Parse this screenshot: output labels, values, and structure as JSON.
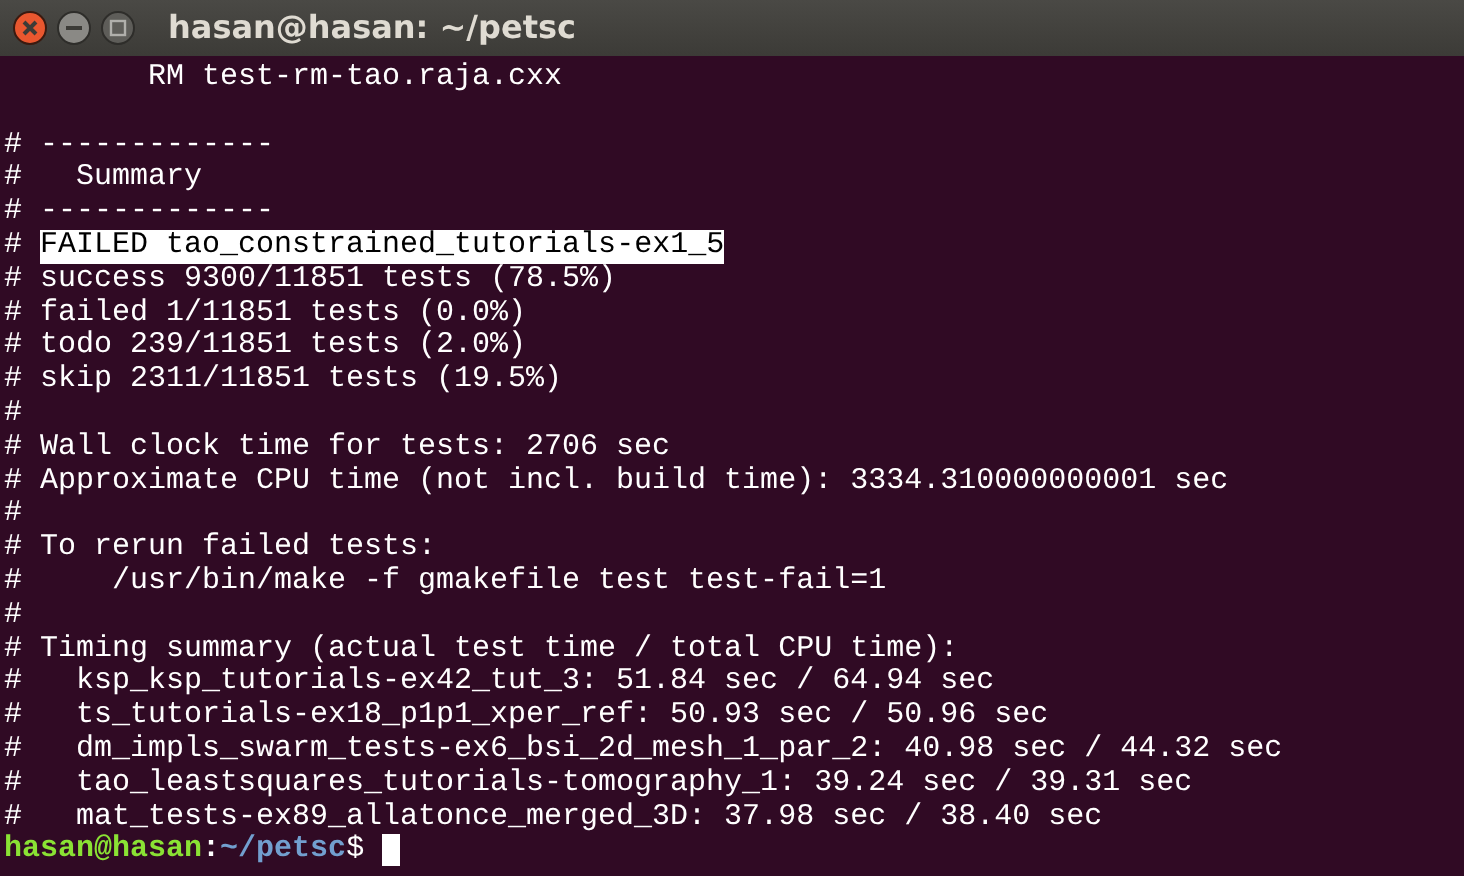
{
  "window": {
    "title": "hasan@hasan: ~/petsc"
  },
  "lines": [
    {
      "kind": "text",
      "text": "        RM test-rm-tao.raja.cxx"
    },
    {
      "kind": "blank"
    },
    {
      "kind": "text",
      "text": "# -------------"
    },
    {
      "kind": "text",
      "text": "#   Summary"
    },
    {
      "kind": "text",
      "text": "# -------------"
    },
    {
      "kind": "highlight",
      "prefix": "# ",
      "text": "FAILED tao_constrained_tutorials-ex1_5"
    },
    {
      "kind": "text",
      "text": "# success 9300/11851 tests (78.5%)"
    },
    {
      "kind": "text",
      "text": "# failed 1/11851 tests (0.0%)"
    },
    {
      "kind": "text",
      "text": "# todo 239/11851 tests (2.0%)"
    },
    {
      "kind": "text",
      "text": "# skip 2311/11851 tests (19.5%)"
    },
    {
      "kind": "text",
      "text": "#"
    },
    {
      "kind": "text",
      "text": "# Wall clock time for tests: 2706 sec"
    },
    {
      "kind": "text",
      "text": "# Approximate CPU time (not incl. build time): 3334.310000000001 sec"
    },
    {
      "kind": "text",
      "text": "#"
    },
    {
      "kind": "text",
      "text": "# To rerun failed tests:"
    },
    {
      "kind": "text",
      "text": "#     /usr/bin/make -f gmakefile test test-fail=1"
    },
    {
      "kind": "text",
      "text": "#"
    },
    {
      "kind": "text",
      "text": "# Timing summary (actual test time / total CPU time):"
    },
    {
      "kind": "text",
      "text": "#   ksp_ksp_tutorials-ex42_tut_3: 51.84 sec / 64.94 sec"
    },
    {
      "kind": "text",
      "text": "#   ts_tutorials-ex18_p1p1_xper_ref: 50.93 sec / 50.96 sec"
    },
    {
      "kind": "text",
      "text": "#   dm_impls_swarm_tests-ex6_bsi_2d_mesh_1_par_2: 40.98 sec / 44.32 sec"
    },
    {
      "kind": "text",
      "text": "#   tao_leastsquares_tutorials-tomography_1: 39.24 sec / 39.31 sec"
    },
    {
      "kind": "text",
      "text": "#   mat_tests-ex89_allatonce_merged_3D: 37.98 sec / 38.40 sec"
    },
    {
      "kind": "prompt",
      "user": "hasan@hasan",
      "sep": ":",
      "path": "~/petsc",
      "symbol": "$"
    }
  ]
}
